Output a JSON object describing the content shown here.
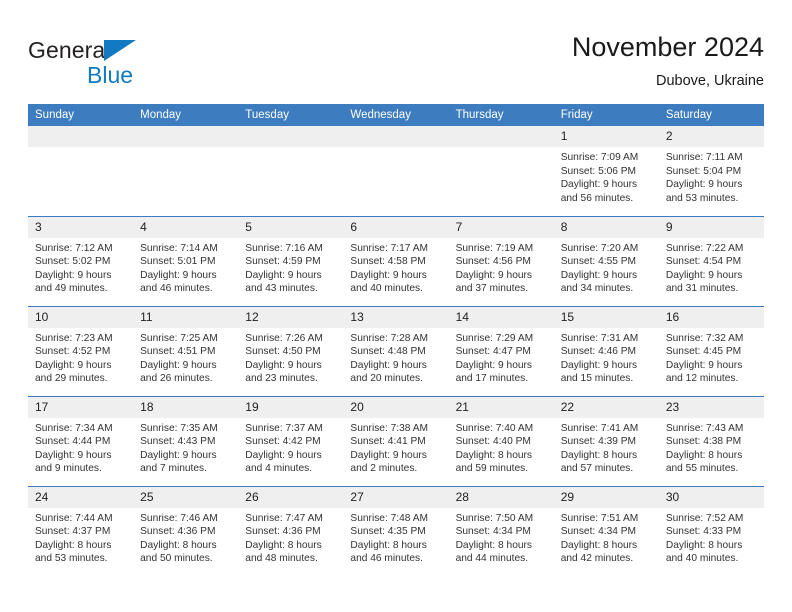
{
  "brand": {
    "name_part1": "General",
    "name_part2": "Blue",
    "triangle_color": "#1279c3"
  },
  "header": {
    "title": "November 2024",
    "location": "Dubove, Ukraine"
  },
  "theme": {
    "header_bg": "#3c7cbf",
    "daynum_bg": "#efefef",
    "text": "#222222"
  },
  "weekday_headers": [
    "Sunday",
    "Monday",
    "Tuesday",
    "Wednesday",
    "Thursday",
    "Friday",
    "Saturday"
  ],
  "weeks": [
    [
      {
        "day": "",
        "sunrise": "",
        "sunset": "",
        "daylight1": "",
        "daylight2": ""
      },
      {
        "day": "",
        "sunrise": "",
        "sunset": "",
        "daylight1": "",
        "daylight2": ""
      },
      {
        "day": "",
        "sunrise": "",
        "sunset": "",
        "daylight1": "",
        "daylight2": ""
      },
      {
        "day": "",
        "sunrise": "",
        "sunset": "",
        "daylight1": "",
        "daylight2": ""
      },
      {
        "day": "",
        "sunrise": "",
        "sunset": "",
        "daylight1": "",
        "daylight2": ""
      },
      {
        "day": "1",
        "sunrise": "Sunrise: 7:09 AM",
        "sunset": "Sunset: 5:06 PM",
        "daylight1": "Daylight: 9 hours",
        "daylight2": "and 56 minutes."
      },
      {
        "day": "2",
        "sunrise": "Sunrise: 7:11 AM",
        "sunset": "Sunset: 5:04 PM",
        "daylight1": "Daylight: 9 hours",
        "daylight2": "and 53 minutes."
      }
    ],
    [
      {
        "day": "3",
        "sunrise": "Sunrise: 7:12 AM",
        "sunset": "Sunset: 5:02 PM",
        "daylight1": "Daylight: 9 hours",
        "daylight2": "and 49 minutes."
      },
      {
        "day": "4",
        "sunrise": "Sunrise: 7:14 AM",
        "sunset": "Sunset: 5:01 PM",
        "daylight1": "Daylight: 9 hours",
        "daylight2": "and 46 minutes."
      },
      {
        "day": "5",
        "sunrise": "Sunrise: 7:16 AM",
        "sunset": "Sunset: 4:59 PM",
        "daylight1": "Daylight: 9 hours",
        "daylight2": "and 43 minutes."
      },
      {
        "day": "6",
        "sunrise": "Sunrise: 7:17 AM",
        "sunset": "Sunset: 4:58 PM",
        "daylight1": "Daylight: 9 hours",
        "daylight2": "and 40 minutes."
      },
      {
        "day": "7",
        "sunrise": "Sunrise: 7:19 AM",
        "sunset": "Sunset: 4:56 PM",
        "daylight1": "Daylight: 9 hours",
        "daylight2": "and 37 minutes."
      },
      {
        "day": "8",
        "sunrise": "Sunrise: 7:20 AM",
        "sunset": "Sunset: 4:55 PM",
        "daylight1": "Daylight: 9 hours",
        "daylight2": "and 34 minutes."
      },
      {
        "day": "9",
        "sunrise": "Sunrise: 7:22 AM",
        "sunset": "Sunset: 4:54 PM",
        "daylight1": "Daylight: 9 hours",
        "daylight2": "and 31 minutes."
      }
    ],
    [
      {
        "day": "10",
        "sunrise": "Sunrise: 7:23 AM",
        "sunset": "Sunset: 4:52 PM",
        "daylight1": "Daylight: 9 hours",
        "daylight2": "and 29 minutes."
      },
      {
        "day": "11",
        "sunrise": "Sunrise: 7:25 AM",
        "sunset": "Sunset: 4:51 PM",
        "daylight1": "Daylight: 9 hours",
        "daylight2": "and 26 minutes."
      },
      {
        "day": "12",
        "sunrise": "Sunrise: 7:26 AM",
        "sunset": "Sunset: 4:50 PM",
        "daylight1": "Daylight: 9 hours",
        "daylight2": "and 23 minutes."
      },
      {
        "day": "13",
        "sunrise": "Sunrise: 7:28 AM",
        "sunset": "Sunset: 4:48 PM",
        "daylight1": "Daylight: 9 hours",
        "daylight2": "and 20 minutes."
      },
      {
        "day": "14",
        "sunrise": "Sunrise: 7:29 AM",
        "sunset": "Sunset: 4:47 PM",
        "daylight1": "Daylight: 9 hours",
        "daylight2": "and 17 minutes."
      },
      {
        "day": "15",
        "sunrise": "Sunrise: 7:31 AM",
        "sunset": "Sunset: 4:46 PM",
        "daylight1": "Daylight: 9 hours",
        "daylight2": "and 15 minutes."
      },
      {
        "day": "16",
        "sunrise": "Sunrise: 7:32 AM",
        "sunset": "Sunset: 4:45 PM",
        "daylight1": "Daylight: 9 hours",
        "daylight2": "and 12 minutes."
      }
    ],
    [
      {
        "day": "17",
        "sunrise": "Sunrise: 7:34 AM",
        "sunset": "Sunset: 4:44 PM",
        "daylight1": "Daylight: 9 hours",
        "daylight2": "and 9 minutes."
      },
      {
        "day": "18",
        "sunrise": "Sunrise: 7:35 AM",
        "sunset": "Sunset: 4:43 PM",
        "daylight1": "Daylight: 9 hours",
        "daylight2": "and 7 minutes."
      },
      {
        "day": "19",
        "sunrise": "Sunrise: 7:37 AM",
        "sunset": "Sunset: 4:42 PM",
        "daylight1": "Daylight: 9 hours",
        "daylight2": "and 4 minutes."
      },
      {
        "day": "20",
        "sunrise": "Sunrise: 7:38 AM",
        "sunset": "Sunset: 4:41 PM",
        "daylight1": "Daylight: 9 hours",
        "daylight2": "and 2 minutes."
      },
      {
        "day": "21",
        "sunrise": "Sunrise: 7:40 AM",
        "sunset": "Sunset: 4:40 PM",
        "daylight1": "Daylight: 8 hours",
        "daylight2": "and 59 minutes."
      },
      {
        "day": "22",
        "sunrise": "Sunrise: 7:41 AM",
        "sunset": "Sunset: 4:39 PM",
        "daylight1": "Daylight: 8 hours",
        "daylight2": "and 57 minutes."
      },
      {
        "day": "23",
        "sunrise": "Sunrise: 7:43 AM",
        "sunset": "Sunset: 4:38 PM",
        "daylight1": "Daylight: 8 hours",
        "daylight2": "and 55 minutes."
      }
    ],
    [
      {
        "day": "24",
        "sunrise": "Sunrise: 7:44 AM",
        "sunset": "Sunset: 4:37 PM",
        "daylight1": "Daylight: 8 hours",
        "daylight2": "and 53 minutes."
      },
      {
        "day": "25",
        "sunrise": "Sunrise: 7:46 AM",
        "sunset": "Sunset: 4:36 PM",
        "daylight1": "Daylight: 8 hours",
        "daylight2": "and 50 minutes."
      },
      {
        "day": "26",
        "sunrise": "Sunrise: 7:47 AM",
        "sunset": "Sunset: 4:36 PM",
        "daylight1": "Daylight: 8 hours",
        "daylight2": "and 48 minutes."
      },
      {
        "day": "27",
        "sunrise": "Sunrise: 7:48 AM",
        "sunset": "Sunset: 4:35 PM",
        "daylight1": "Daylight: 8 hours",
        "daylight2": "and 46 minutes."
      },
      {
        "day": "28",
        "sunrise": "Sunrise: 7:50 AM",
        "sunset": "Sunset: 4:34 PM",
        "daylight1": "Daylight: 8 hours",
        "daylight2": "and 44 minutes."
      },
      {
        "day": "29",
        "sunrise": "Sunrise: 7:51 AM",
        "sunset": "Sunset: 4:34 PM",
        "daylight1": "Daylight: 8 hours",
        "daylight2": "and 42 minutes."
      },
      {
        "day": "30",
        "sunrise": "Sunrise: 7:52 AM",
        "sunset": "Sunset: 4:33 PM",
        "daylight1": "Daylight: 8 hours",
        "daylight2": "and 40 minutes."
      }
    ]
  ]
}
